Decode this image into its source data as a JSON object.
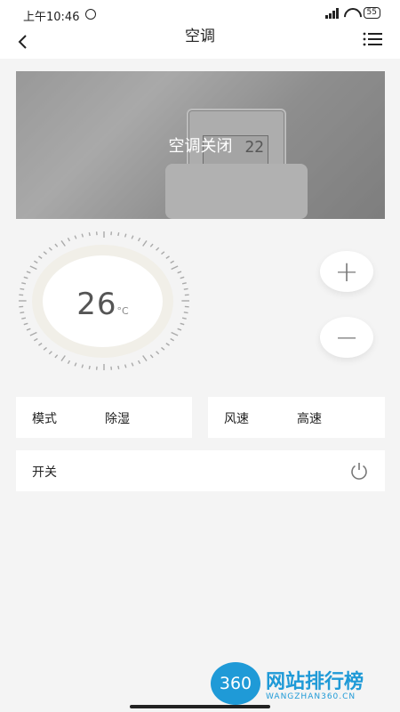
{
  "status_bar": {
    "time": "上午10:46",
    "battery": "55"
  },
  "header": {
    "title": "空调"
  },
  "banner": {
    "label": "空调关闭",
    "device_reading": "22"
  },
  "dial": {
    "temperature": "26",
    "unit": "°C"
  },
  "controls": {
    "plus": "+",
    "minus": "−"
  },
  "mode": {
    "label": "模式",
    "value": "除湿"
  },
  "speed": {
    "label": "风速",
    "value": "高速"
  },
  "switch": {
    "label": "开关"
  },
  "watermark": {
    "logo_text": "360",
    "text": "网站排行榜",
    "sub": "WANGZHAN360.CN"
  },
  "colors": {
    "accent": "#1f9ad7",
    "background": "#f4f4f4"
  },
  "icons": [
    "back-icon",
    "menu-icon",
    "power-icon",
    "alarm-icon",
    "wifi-icon",
    "signal-icon",
    "battery-icon"
  ]
}
